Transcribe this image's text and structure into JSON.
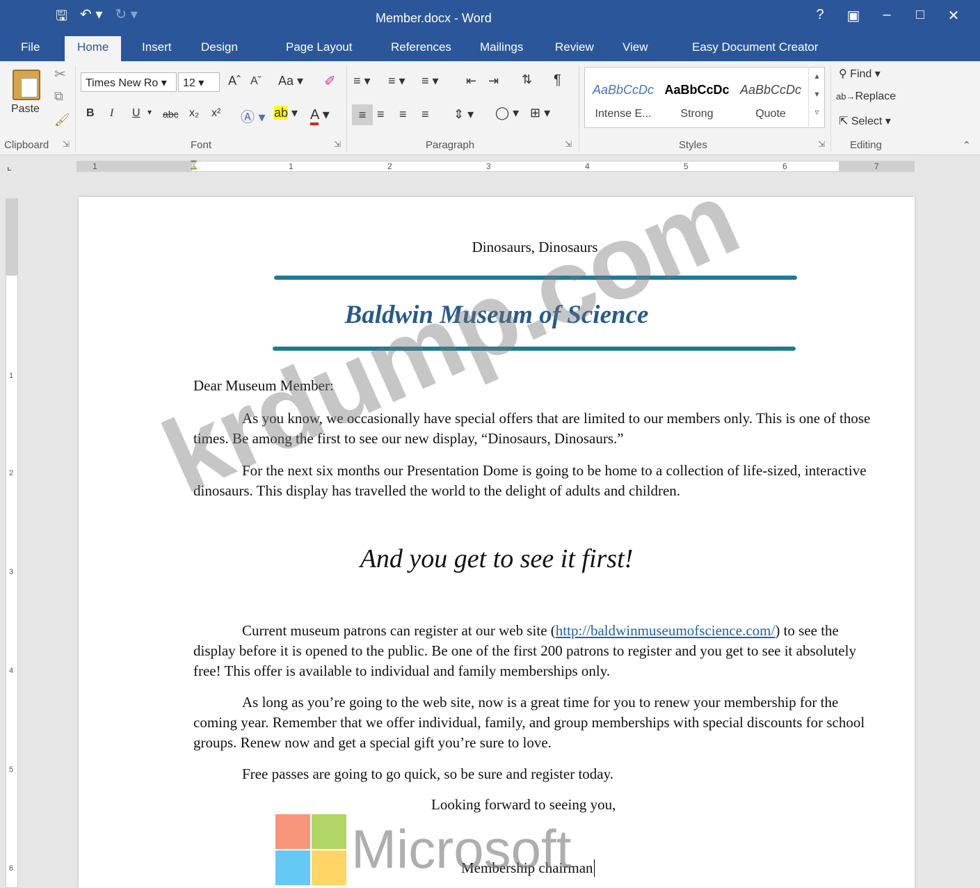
{
  "window": {
    "title": "Member.docx  - Word",
    "help": "?",
    "colors": {
      "titlebar": "#2b579a",
      "accent_rule": "#1e7a96",
      "heading": "#255b8c"
    }
  },
  "qat": {
    "save_icon": "save-icon",
    "undo_icon": "undo-icon",
    "redo_icon": "redo-icon"
  },
  "tabs": [
    "File",
    "Home",
    "Insert",
    "Design",
    "Page Layout",
    "References",
    "Mailings",
    "Review",
    "View",
    "Easy Document Creator"
  ],
  "ribbon": {
    "clipboard": {
      "paste": "Paste",
      "label": "Clipboard"
    },
    "font": {
      "name": "Times New Ro",
      "size": "12",
      "case": "Aa",
      "bold": "B",
      "italic": "I",
      "underline": "U",
      "strike": "abc",
      "sub": "x₂",
      "sup": "x²",
      "label": "Font"
    },
    "paragraph": {
      "label": "Paragraph"
    },
    "styles": {
      "label": "Styles",
      "items": [
        {
          "sample": "AaBbCcDc",
          "name": "Intense E..."
        },
        {
          "sample": "AaBbCcDc",
          "name": "Strong"
        },
        {
          "sample": "AaBbCcDc",
          "name": "Quote"
        }
      ]
    },
    "editing": {
      "find": "Find",
      "replace": "Replace",
      "select": "Select",
      "label": "Editing"
    }
  },
  "ruler": [
    "1",
    "1",
    "2",
    "3",
    "4",
    "5",
    "6",
    "7"
  ],
  "vruler": [
    "1",
    "2",
    "3",
    "4",
    "5",
    "6"
  ],
  "document": {
    "header_line": "Dinosaurs, Dinosaurs",
    "heading": "Baldwin Museum of Science",
    "salutation": "Dear Museum Member:",
    "p1": "As you know, we occasionally have special offers that are limited to our members only. This is one of those times. Be among the first to see our new display, “Dinosaurs, Dinosaurs.”",
    "p2": "For the next six months our Presentation Dome is going to be home to a collection of life-sized, interactive dinosaurs. This display has travelled the world to the delight of adults and children.",
    "tagline": "And you get to see it first!",
    "p3_before": "Current museum patrons can register at our web site (",
    "p3_link": "http://baldwinmuseumofscience.com/",
    "p3_after": ") to see the display before it is opened to the public. Be one of the first 200 patrons to register and you get to see it absolutely free! This offer is available to individual and family memberships only.",
    "p4": "As long as you’re going to the web site, now is a great time for you to renew your membership for the coming year. Remember that we offer individual, family, and group memberships with special discounts for school groups. Renew now and get a special gift you’re sure to love.",
    "p5": "Free passes are going to go quick, so be sure and register today.",
    "closing": "Looking forward to seeing you,",
    "signature": "Membership chairman"
  },
  "watermarks": {
    "site": "krdump.com",
    "brand": "Microsoft"
  }
}
